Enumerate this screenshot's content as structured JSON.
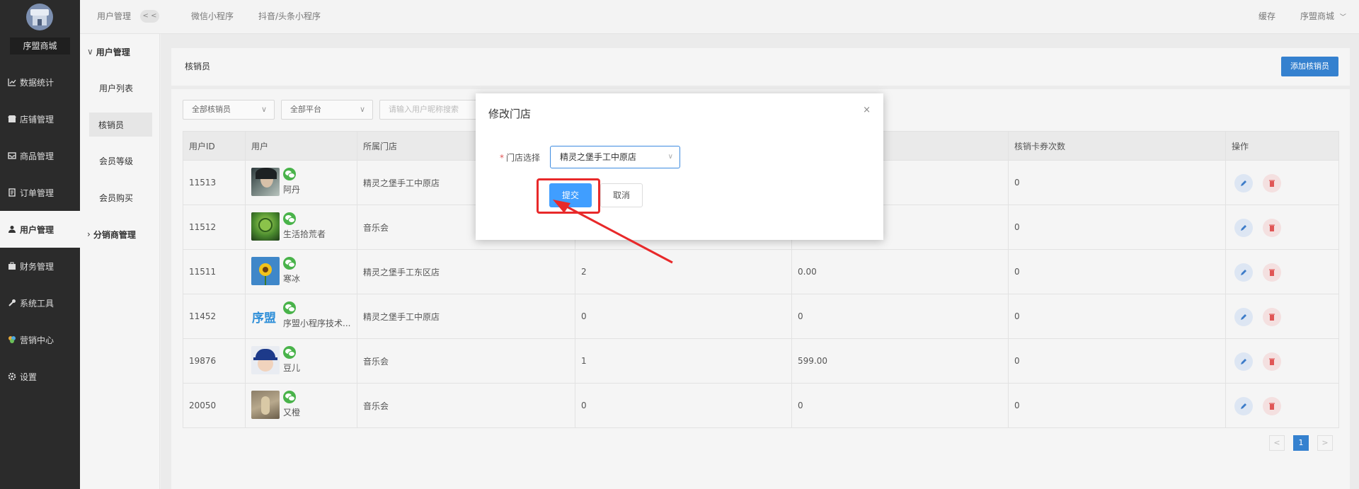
{
  "sidebar": {
    "shop_name": "序盟商城",
    "items": [
      {
        "label": "数据统计",
        "icon": "chart-icon"
      },
      {
        "label": "店铺管理",
        "icon": "store-icon"
      },
      {
        "label": "商品管理",
        "icon": "goods-icon"
      },
      {
        "label": "订单管理",
        "icon": "order-icon"
      },
      {
        "label": "用户管理",
        "icon": "user-icon",
        "active": true
      },
      {
        "label": "财务管理",
        "icon": "finance-icon"
      },
      {
        "label": "系统工具",
        "icon": "wrench-icon"
      },
      {
        "label": "营销中心",
        "icon": "marketing-icon"
      },
      {
        "label": "设置",
        "icon": "gear-icon"
      }
    ]
  },
  "submenu": {
    "head": "用户管理",
    "items": [
      "用户列表",
      "核销员",
      "会员等级",
      "会员购买"
    ],
    "bottom": "分销商管理"
  },
  "topbar": {
    "section": "用户管理",
    "collapse": "< <",
    "tabs": [
      "微信小程序",
      "抖音/头条小程序"
    ],
    "cache": "缓存",
    "user": "序盟商城"
  },
  "page": {
    "title": "核销员",
    "add_button": "添加核销员",
    "filters": {
      "verifier": "全部核销员",
      "platform": "全部平台",
      "search_placeholder": "请输入用户昵称搜索"
    },
    "columns": [
      "用户ID",
      "用户",
      "所属门店",
      "",
      "",
      "核销卡券次数",
      "操作"
    ],
    "rows": [
      {
        "id": "11513",
        "name": "阿丹",
        "store": "精灵之堡手工中原店",
        "c4": "",
        "c5": "",
        "cards": "0"
      },
      {
        "id": "11512",
        "name": "生活拾荒者",
        "store": "音乐会",
        "c4": "",
        "c5": "",
        "cards": "0"
      },
      {
        "id": "11511",
        "name": "寒冰",
        "store": "精灵之堡手工东区店",
        "c4": "2",
        "c5": "0.00",
        "cards": "0"
      },
      {
        "id": "11452",
        "name": "序盟小程序技术...",
        "store": "精灵之堡手工中原店",
        "c4": "0",
        "c5": "0",
        "cards": "0"
      },
      {
        "id": "19876",
        "name": "豆儿",
        "store": "音乐会",
        "c4": "1",
        "c5": "599.00",
        "cards": "0"
      },
      {
        "id": "20050",
        "name": "又橙",
        "store": "音乐会",
        "c4": "0",
        "c5": "0",
        "cards": "0"
      }
    ],
    "pager": {
      "prev": "<",
      "current": "1",
      "next": ">"
    }
  },
  "modal": {
    "title": "修改门店",
    "field_label": "门店选择",
    "selected_store": "精灵之堡手工中原店",
    "submit": "提交",
    "cancel": "取消",
    "close": "×"
  },
  "logo_text": "序盟",
  "colors": {
    "primary": "#409eff",
    "highlight": "#e8292a",
    "sidebar": "#2b2b2b"
  }
}
